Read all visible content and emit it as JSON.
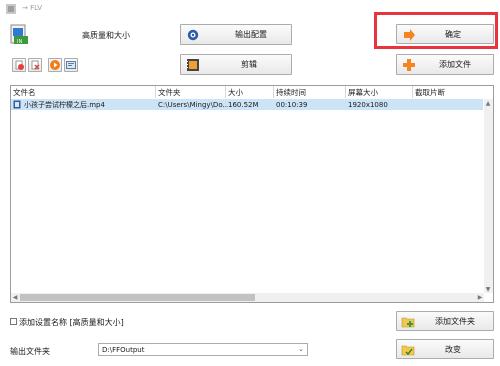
{
  "window": {
    "title": "→ FLV"
  },
  "quality": {
    "label": "高质量和大小"
  },
  "toolbar": {
    "output_config_label": "输出配置",
    "clip_label": "剪辑",
    "ok_label": "确定",
    "add_file_label": "添加文件"
  },
  "table": {
    "columns": [
      "文件名",
      "文件夹",
      "大小",
      "持续时间",
      "屏幕大小",
      "截取片断"
    ],
    "rows": [
      {
        "name": "小孩子尝试柠檬之后.mp4",
        "folder": "C:\\Users\\Mingy\\Do...",
        "size": "160.52M",
        "duration": "00:10:39",
        "screen": "1920x1080",
        "clip": ""
      }
    ]
  },
  "bottom": {
    "add_setting_name_label": "添加设置名称 [高质量和大小]",
    "add_folder_label": "添加文件夹",
    "change_label": "改变",
    "output_folder_label": "输出文件夹",
    "output_folder_value": "D:\\FFOutput"
  },
  "colors": {
    "highlight": "#e8343f",
    "selection": "#cde4f7",
    "accent_orange": "#f5861f"
  }
}
